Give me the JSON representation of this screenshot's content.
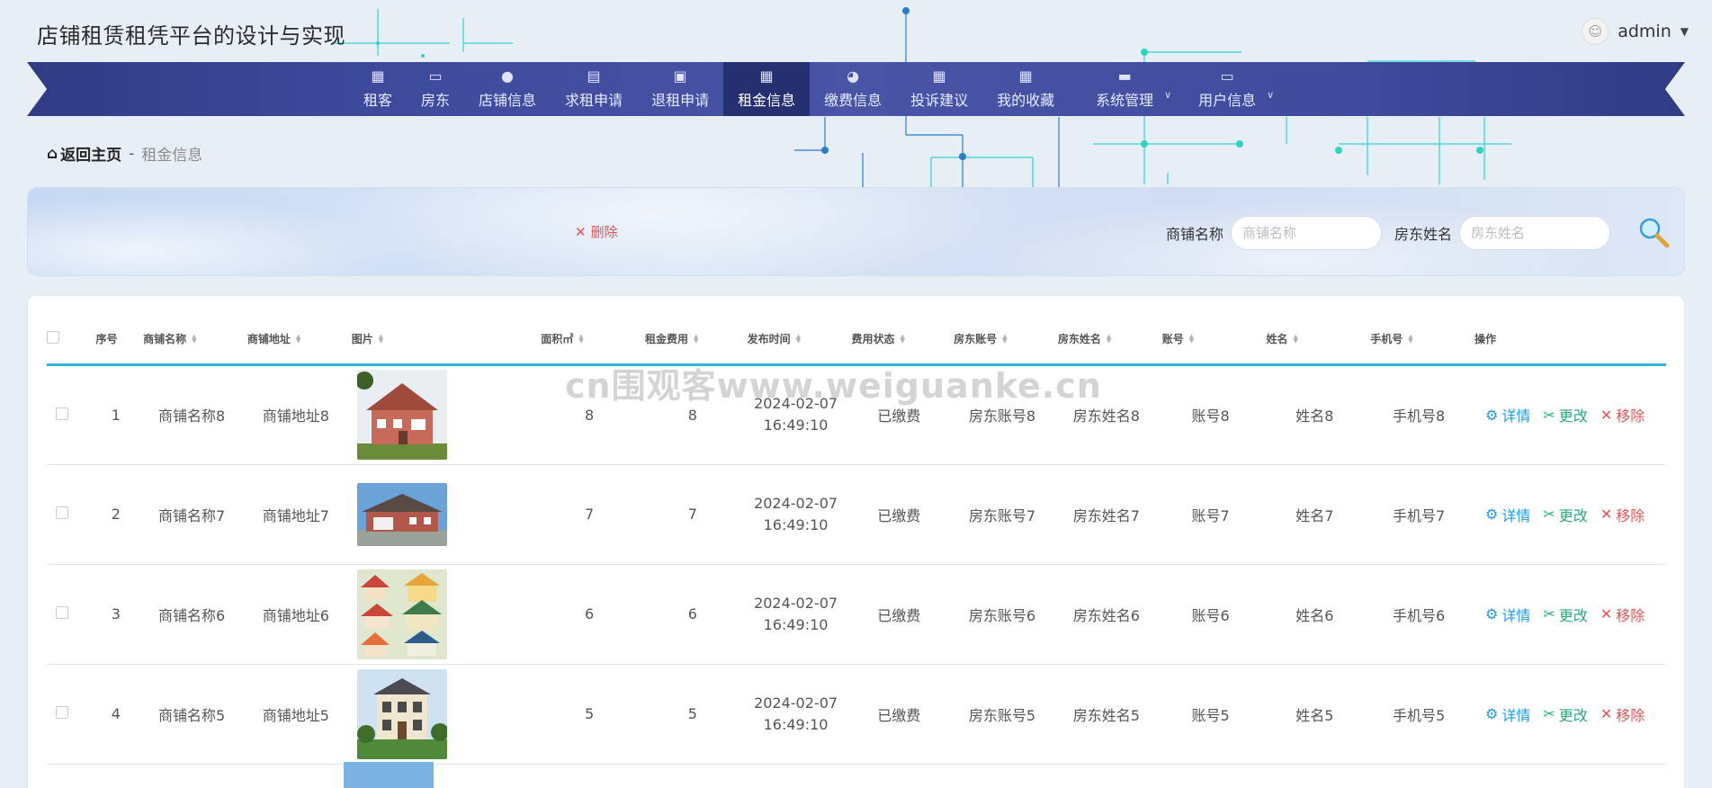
{
  "app": {
    "title": "店铺租赁租凭平台的设计与实现",
    "username": "admin"
  },
  "nav": {
    "items": [
      {
        "label": "租客",
        "icon": "grid-icon"
      },
      {
        "label": "房东",
        "icon": "monitor-icon"
      },
      {
        "label": "店铺信息",
        "icon": "person-icon"
      },
      {
        "label": "求租申请",
        "icon": "chat-icon"
      },
      {
        "label": "退租申请",
        "icon": "clipboard-icon"
      },
      {
        "label": "租金信息",
        "icon": "grid-icon",
        "active": true
      },
      {
        "label": "缴费信息",
        "icon": "bulb-icon"
      },
      {
        "label": "投诉建议",
        "icon": "grid-icon"
      },
      {
        "label": "我的收藏",
        "icon": "grid-icon"
      },
      {
        "label": "系统管理",
        "icon": "briefcase-icon",
        "dropdown": true
      },
      {
        "label": "用户信息",
        "icon": "card-icon",
        "dropdown": true
      }
    ]
  },
  "breadcrumb": {
    "home": "返回主页",
    "separator": "-",
    "current": "租金信息"
  },
  "toolbar": {
    "delete_label": "删除",
    "shop_name_label": "商铺名称",
    "shop_name_placeholder": "商铺名称",
    "landlord_name_label": "房东姓名",
    "landlord_name_placeholder": "房东姓名"
  },
  "table": {
    "columns": [
      "序号",
      "商铺名称",
      "商铺地址",
      "图片",
      "面积㎡",
      "租金费用",
      "发布时间",
      "费用状态",
      "房东账号",
      "房东姓名",
      "账号",
      "姓名",
      "手机号",
      "操作"
    ],
    "rows": [
      {
        "no": "1",
        "shop": "商铺名称8",
        "addr": "商铺地址8",
        "img": "house-a",
        "area": "8",
        "rent": "8",
        "date": "2024-02-07",
        "time": "16:49:10",
        "status": "已缴费",
        "lacc": "房东账号8",
        "lname": "房东姓名8",
        "acc": "账号8",
        "name": "姓名8",
        "phone": "手机号8"
      },
      {
        "no": "2",
        "shop": "商铺名称7",
        "addr": "商铺地址7",
        "img": "house-b",
        "area": "7",
        "rent": "7",
        "date": "2024-02-07",
        "time": "16:49:10",
        "status": "已缴费",
        "lacc": "房东账号7",
        "lname": "房东姓名7",
        "acc": "账号7",
        "name": "姓名7",
        "phone": "手机号7"
      },
      {
        "no": "3",
        "shop": "商铺名称6",
        "addr": "商铺地址6",
        "img": "house-c",
        "area": "6",
        "rent": "6",
        "date": "2024-02-07",
        "time": "16:49:10",
        "status": "已缴费",
        "lacc": "房东账号6",
        "lname": "房东姓名6",
        "acc": "账号6",
        "name": "姓名6",
        "phone": "手机号6"
      },
      {
        "no": "4",
        "shop": "商铺名称5",
        "addr": "商铺地址5",
        "img": "house-d",
        "area": "5",
        "rent": "5",
        "date": "2024-02-07",
        "time": "16:49:10",
        "status": "已缴费",
        "lacc": "房东账号5",
        "lname": "房东姓名5",
        "acc": "账号5",
        "name": "姓名5",
        "phone": "手机号5"
      }
    ],
    "actions": {
      "detail": "详情",
      "edit": "更改",
      "remove": "移除"
    }
  },
  "watermark": "cn围观客www.weiguanke.cn",
  "colors": {
    "nav_bg": "#3d4a9b",
    "nav_active": "#262f70",
    "header_rule": "#2bb8d9",
    "detail": "#1e9be6",
    "edit": "#2aa77f",
    "remove": "#e05555"
  }
}
